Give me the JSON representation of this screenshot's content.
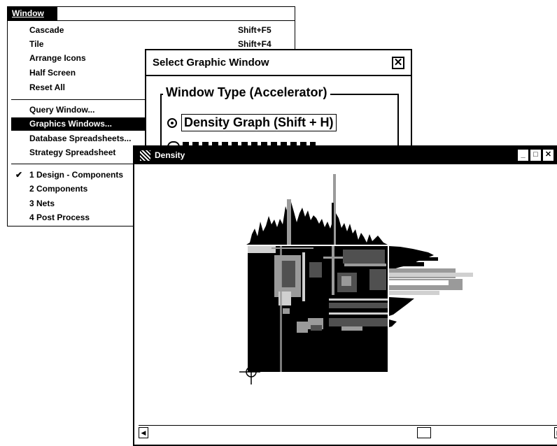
{
  "menu": {
    "title": "Window",
    "items": [
      {
        "label": "Cascade",
        "shortcut": "Shift+F5"
      },
      {
        "label": "Tile",
        "shortcut": "Shift+F4"
      },
      {
        "label": "Arrange Icons",
        "shortcut": ""
      },
      {
        "label": "Half Screen",
        "shortcut": ""
      },
      {
        "label": "Reset All",
        "shortcut": ""
      },
      {
        "label": "Query Window...",
        "shortcut": ""
      },
      {
        "label": "Graphics Windows...",
        "shortcut": ""
      },
      {
        "label": "Database Spreadsheets...",
        "shortcut": ""
      },
      {
        "label": "Strategy Spreadsheet",
        "shortcut": ""
      },
      {
        "label": "1 Design - Components",
        "shortcut": "",
        "checked": true
      },
      {
        "label": "2 Components",
        "shortcut": ""
      },
      {
        "label": "3 Nets",
        "shortcut": ""
      },
      {
        "label": "4 Post Process",
        "shortcut": ""
      }
    ],
    "selected_item": "Graphics Windows..."
  },
  "dialog": {
    "title": "Select Graphic Window",
    "close_glyph": "✕",
    "group_title": "Window Type (Accelerator)",
    "selected_option": "Density Graph (Shift + H)"
  },
  "density_window": {
    "title": "Density",
    "controls": {
      "minimize": "_",
      "maximize": "□",
      "close": "✕"
    },
    "scroll_left": "◀",
    "scroll_right": "▶"
  },
  "colors": {
    "selection": "#000000",
    "background": "#ffffff",
    "graph_gray": "#9a9a9a",
    "graph_light": "#d0d0d0"
  },
  "icons": [
    "window-control-icon",
    "radio-selected-icon",
    "crosshair-icon"
  ]
}
